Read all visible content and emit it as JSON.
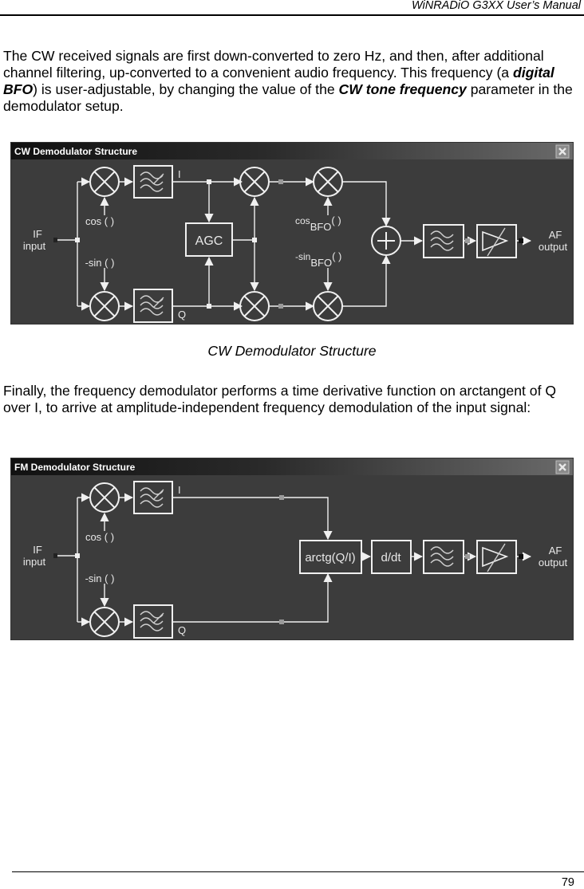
{
  "header": {
    "running_title": "WiNRADiO G3XX User’s Manual"
  },
  "paragraph_1": {
    "part_1": "The CW received signals are first down-converted to zero Hz, and then, after additional channel filtering, up-converted to a convenient audio frequency. This frequency (a ",
    "bold_1": "digital BFO",
    "part_2": ") is user-adjustable, by changing the value of the ",
    "bold_2": "CW tone frequency",
    "part_3": " parameter in the demodulator setup."
  },
  "cw_diagram": {
    "window_title": "CW Demodulator Structure",
    "close_icon": "close-icon",
    "labels": {
      "if_line1": "IF",
      "if_line2": "input",
      "cos": "cos ( )",
      "neg_sin": "-sin ( )",
      "i": "I",
      "q": "Q",
      "agc": "AGC",
      "cos_bfo_pre": "cos",
      "cos_bfo_sub": "BFO",
      "cos_bfo_post": "( )",
      "sin_bfo_pre": "-sin",
      "sin_bfo_sub": "BFO",
      "sin_bfo_post": "( )",
      "af_line1": "AF",
      "af_line2": "output"
    }
  },
  "cw_caption": "CW Demodulator Structure",
  "paragraph_2": "Finally, the frequency demodulator performs a time derivative function on arctangent of Q over I, to arrive at amplitude-independent frequency demodulation of the input signal:",
  "fm_diagram": {
    "window_title": "FM Demodulator Structure",
    "close_icon": "close-icon",
    "labels": {
      "if_line1": "IF",
      "if_line2": "input",
      "cos": "cos ( )",
      "neg_sin": "-sin ( )",
      "i": "I",
      "q": "Q",
      "arctg": "arctg(Q/I)",
      "ddt": "d/dt",
      "af_line1": "AF",
      "af_line2": "output"
    }
  },
  "footer": {
    "page_number": "79"
  },
  "colors": {
    "diagram_bg": "#3c3c3c",
    "titlebar": "#1a1a1a",
    "stroke": "#f0f0f0",
    "connector_grey": "#9a9a9a"
  }
}
